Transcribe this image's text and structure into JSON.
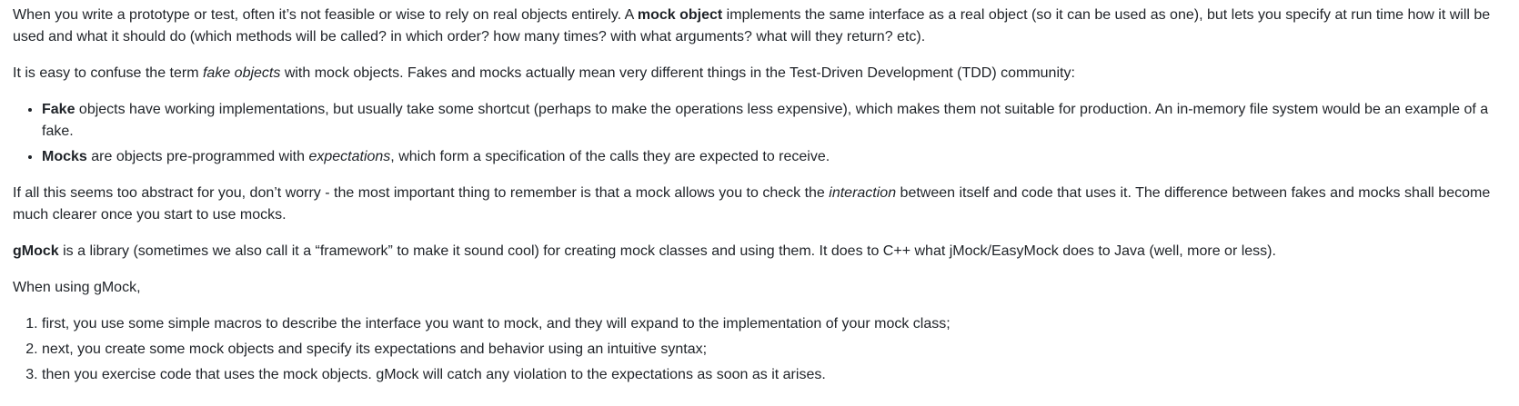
{
  "p1": {
    "t1": "When you write a prototype or test, often it’s not feasible or wise to rely on real objects entirely. A ",
    "b1": "mock object",
    "t2": " implements the same interface as a real object (so it can be used as one), but lets you specify at run time how it will be used and what it should do (which methods will be called? in which order? how many times? with what arguments? what will they return? etc)."
  },
  "p2": {
    "t1": "It is easy to confuse the term ",
    "i1": "fake objects",
    "t2": " with mock objects. Fakes and mocks actually mean very different things in the Test-Driven Development (TDD) community:"
  },
  "bullets": [
    {
      "b": "Fake",
      "t1": " objects have working implementations, but usually take some shortcut (perhaps to make the operations less expensive), which makes them not suitable for production. An in-memory file system would be an example of a fake."
    },
    {
      "b": "Mocks",
      "t1": " are objects pre-programmed with ",
      "i": "expectations",
      "t2": ", which form a specification of the calls they are expected to receive."
    }
  ],
  "p3": {
    "t1": "If all this seems too abstract for you, don’t worry - the most important thing to remember is that a mock allows you to check the ",
    "i1": "interaction",
    "t2": " between itself and code that uses it. The difference between fakes and mocks shall become much clearer once you start to use mocks."
  },
  "p4": {
    "b1": "gMock",
    "t1": " is a library (sometimes we also call it a “framework” to make it sound cool) for creating mock classes and using them. It does to C++ what jMock/EasyMock does to Java (well, more or less)."
  },
  "p5": {
    "t1": "When using gMock,"
  },
  "steps": [
    "first, you use some simple macros to describe the interface you want to mock, and they will expand to the implementation of your mock class;",
    "next, you create some mock objects and specify its expectations and behavior using an intuitive syntax;",
    "then you exercise code that uses the mock objects. gMock will catch any violation to the expectations as soon as it arises."
  ]
}
